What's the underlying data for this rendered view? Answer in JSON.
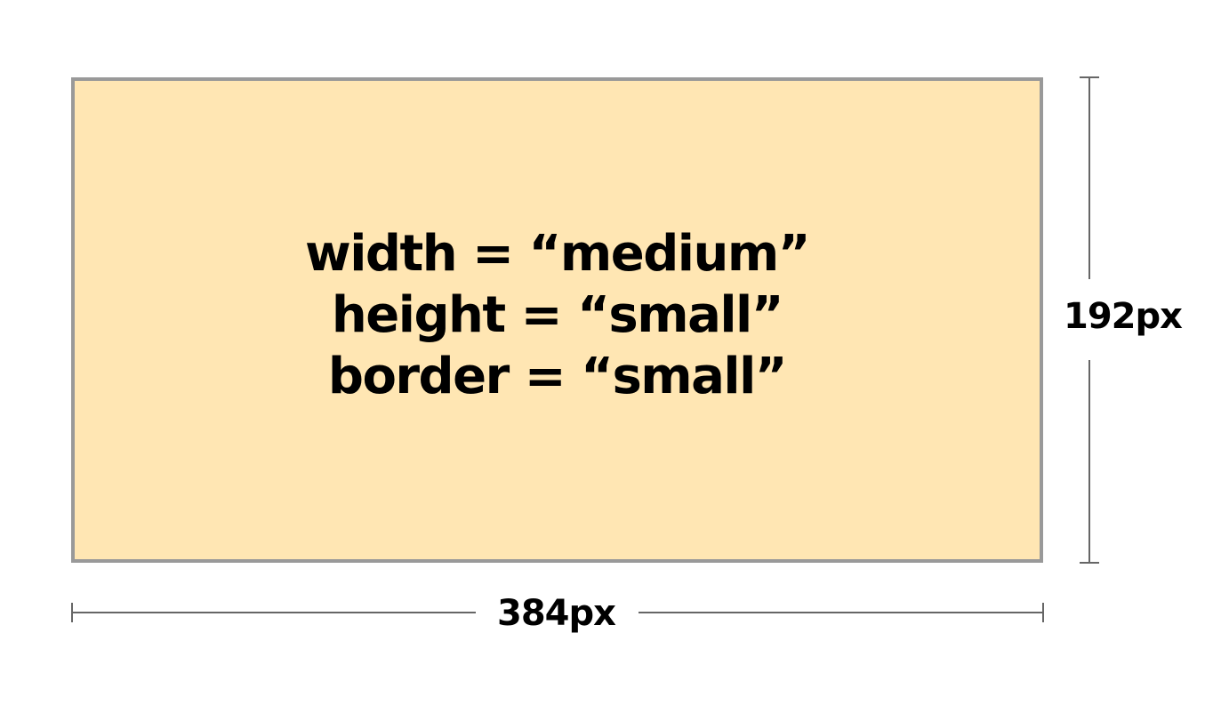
{
  "colors": {
    "box_fill": "#FFE6B3",
    "box_border": "#999999",
    "dimension_line": "#666666",
    "text": "#000000"
  },
  "box": {
    "lines": [
      "width = “medium”",
      "height = “small”",
      "border = “small”"
    ]
  },
  "dimensions": {
    "height_label": "192px",
    "width_label": "384px"
  }
}
